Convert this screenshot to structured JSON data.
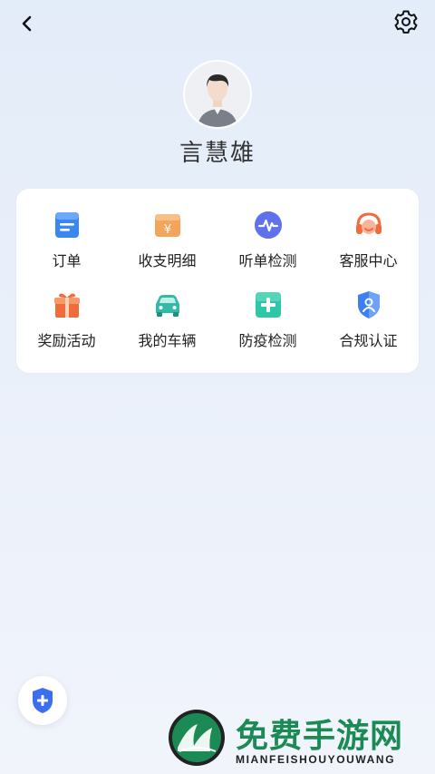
{
  "profile": {
    "name": "言慧雄"
  },
  "menu": [
    {
      "label": "订单",
      "icon": "order-icon"
    },
    {
      "label": "收支明细",
      "icon": "income-expense-icon"
    },
    {
      "label": "听单检测",
      "icon": "order-listening-check-icon"
    },
    {
      "label": "客服中心",
      "icon": "customer-service-icon"
    },
    {
      "label": "奖励活动",
      "icon": "gift-icon"
    },
    {
      "label": "我的车辆",
      "icon": "car-icon"
    },
    {
      "label": "防疫检测",
      "icon": "medical-cross-icon"
    },
    {
      "label": "合规认证",
      "icon": "shield-person-icon"
    }
  ],
  "watermark": {
    "title": "免费手游网",
    "subtitle": "MIANFEISHOUYOUWANG"
  },
  "colors": {
    "accent_blue": "#3b6ff0",
    "orange": "#f29a3a",
    "teal": "#38c5b0",
    "watermark_green": "#1c8a55"
  }
}
